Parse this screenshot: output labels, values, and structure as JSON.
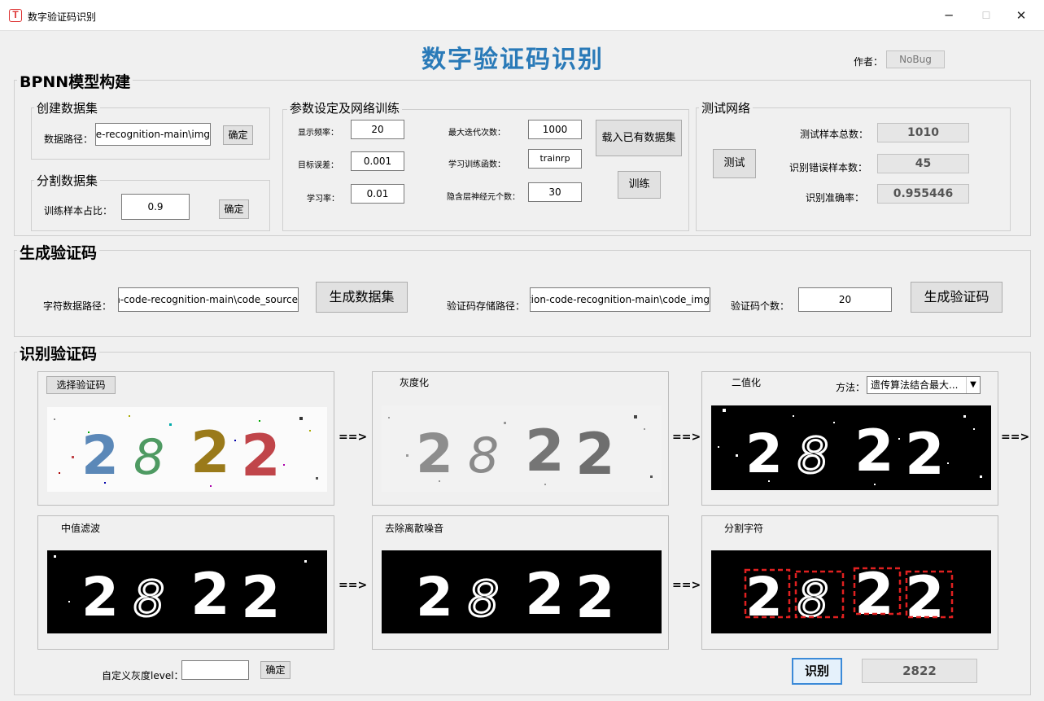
{
  "window": {
    "title": "数字验证码识别",
    "app_icon": "T",
    "minimize": "─",
    "maximize": "☐",
    "close": "✕"
  },
  "header": {
    "title": "数字验证码识别",
    "author_label": "作者：",
    "author_value": "NoBug"
  },
  "bpnn": {
    "legend": "BPNN模型构建",
    "create": {
      "legend": "创建数据集",
      "path_label": "数据路径：",
      "path_value": "e-recognition-main\\img\\",
      "confirm": "确定"
    },
    "split": {
      "legend": "分割数据集",
      "ratio_label": "训练样本占比：",
      "ratio_value": "0.9",
      "confirm": "确定"
    },
    "params": {
      "legend": "参数设定及网络训练",
      "show_freq_label": "显示频率：",
      "show_freq_value": "20",
      "goal_label": "目标误差：",
      "goal_value": "0.001",
      "lr_label": "学习率：",
      "lr_value": "0.01",
      "epochs_label": "最大迭代次数：",
      "epochs_value": "1000",
      "train_fn_label": "学习训练函数：",
      "train_fn_value": "trainrp",
      "hidden_label": "隐含层神经元个数：",
      "hidden_value": "30",
      "load_button": "载入已有数据集",
      "train_button": "训练"
    },
    "test": {
      "legend": "测试网络",
      "test_button": "测试",
      "total_label": "测试样本总数：",
      "total_value": "1010",
      "errors_label": "识别错误样本数：",
      "errors_value": "45",
      "accuracy_label": "识别准确率：",
      "accuracy_value": "0.955446"
    }
  },
  "generate": {
    "legend": "生成验证码",
    "char_path_label": "字符数据路径：",
    "char_path_value": "n-code-recognition-main\\code_source\\",
    "make_dataset_button": "生成数据集",
    "save_path_label": "验证码存储路径：",
    "save_path_value": "tion-code-recognition-main\\code_img\\",
    "count_label": "验证码个数：",
    "count_value": "20",
    "generate_button": "生成验证码"
  },
  "recognize": {
    "legend": "识别验证码",
    "select_button": "选择验证码",
    "gray_label": "灰度化",
    "binary_label": "二值化",
    "method_label": "方法：",
    "method_value": "遗传算法结合最大...",
    "median_label": "中值滤波",
    "denoise_label": "去除离散噪音",
    "segment_label": "分割字符",
    "arrow": "==>",
    "captcha_text": "2822",
    "custom_gray_label": "自定义灰度level：",
    "custom_gray_value": "",
    "custom_confirm": "确定",
    "recognize_button": "识别",
    "result_value": "2822"
  },
  "colors": {
    "title_blue": "#2a7ab8",
    "digit_blue": "#5b88b8",
    "digit_green": "#4e9a62",
    "digit_gold": "#9a7a1a",
    "digit_red": "#c0454a",
    "seg_box": "#e02020"
  }
}
